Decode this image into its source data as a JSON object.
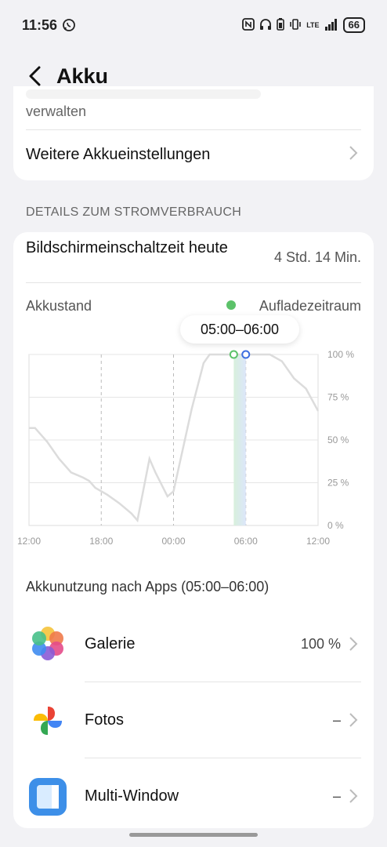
{
  "status": {
    "time": "11:56",
    "lte": "LTE",
    "battery": "66"
  },
  "header": {
    "title": "Akku"
  },
  "settings": {
    "partial_text": "verwalten",
    "more_settings": "Weitere Akkueinstellungen"
  },
  "section": {
    "title": "DETAILS ZUM STROMVERBRAUCH"
  },
  "screen_time": {
    "label": "Bildschirmeinschaltzeit heute",
    "value": "4 Std. 14 Min."
  },
  "battery_chart": {
    "label": "Akkustand",
    "legend": "Aufladezeitraum",
    "tooltip": "05:00–06:00",
    "charging_color": "#5cc26a",
    "selected_color": "#3d6ee0"
  },
  "chart_data": {
    "type": "line",
    "x_labels": [
      "12:00",
      "18:00",
      "00:00",
      "06:00",
      "12:00"
    ],
    "y_labels": [
      "100 %",
      "75 %",
      "50 %",
      "25 %",
      "0 %"
    ],
    "ylim": [
      0,
      100
    ],
    "grid": true,
    "series": [
      {
        "values": [
          {
            "t": 0,
            "v": 57
          },
          {
            "t": 0.5,
            "v": 57
          },
          {
            "t": 1.5,
            "v": 49
          },
          {
            "t": 2.5,
            "v": 39
          },
          {
            "t": 3.5,
            "v": 31
          },
          {
            "t": 4.5,
            "v": 28
          },
          {
            "t": 5.0,
            "v": 26
          },
          {
            "t": 5.5,
            "v": 22
          },
          {
            "t": 6.5,
            "v": 18
          },
          {
            "t": 7.5,
            "v": 13
          },
          {
            "t": 8.5,
            "v": 7
          },
          {
            "t": 9.0,
            "v": 3
          },
          {
            "t": 10.0,
            "v": 39
          },
          {
            "t": 10.5,
            "v": 31
          },
          {
            "t": 11.5,
            "v": 17
          },
          {
            "t": 12.0,
            "v": 20
          },
          {
            "t": 13.5,
            "v": 68
          },
          {
            "t": 14.5,
            "v": 95
          },
          {
            "t": 15.0,
            "v": 100
          },
          {
            "t": 18.0,
            "v": 100
          },
          {
            "t": 19.0,
            "v": 100
          },
          {
            "t": 20.0,
            "v": 100
          },
          {
            "t": 21.0,
            "v": 96
          },
          {
            "t": 22.0,
            "v": 86
          },
          {
            "t": 23.0,
            "v": 80
          },
          {
            "t": 24.0,
            "v": 67
          }
        ]
      }
    ],
    "highlight": {
      "from": 17,
      "to": 18
    }
  },
  "apps_section": {
    "title": "Akkunutzung nach Apps (05:00–06:00)"
  },
  "apps": [
    {
      "name": "Galerie",
      "value": "100 %",
      "icon": "gallery-icon"
    },
    {
      "name": "Fotos",
      "value": "–",
      "icon": "photos-icon"
    },
    {
      "name": "Multi-Window",
      "value": "–",
      "icon": "multi-window-icon"
    }
  ]
}
